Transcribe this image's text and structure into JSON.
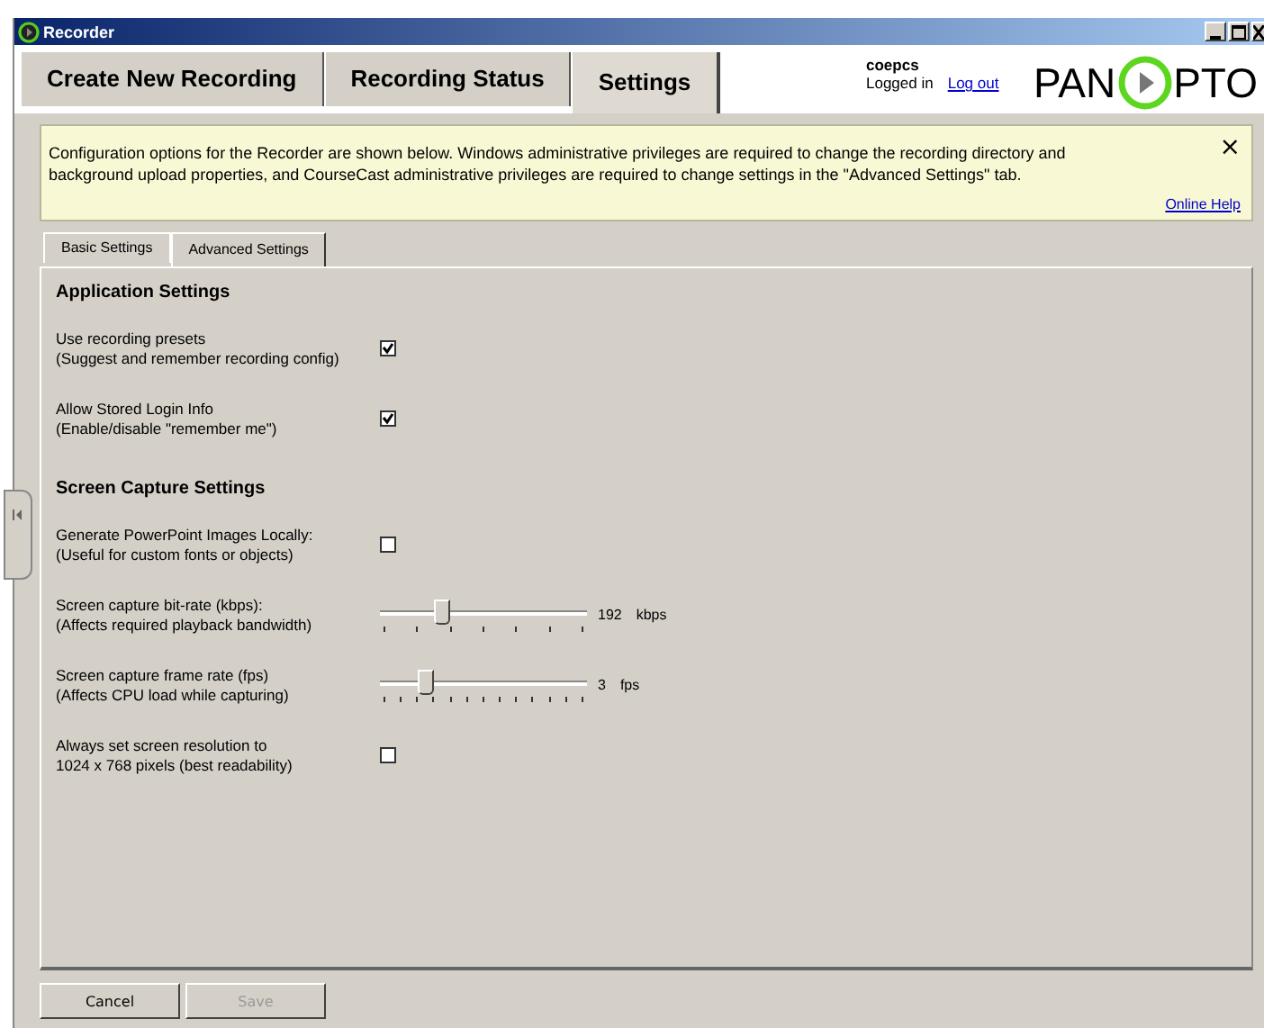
{
  "window": {
    "title": "Recorder"
  },
  "tabs": [
    {
      "label": "Create New Recording",
      "selected": false
    },
    {
      "label": "Recording Status",
      "selected": false
    },
    {
      "label": "Settings",
      "selected": true
    }
  ],
  "user": {
    "name": "coepcs",
    "status": "Logged in",
    "logout": "Log out"
  },
  "logo": {
    "left": "PAN",
    "right": "PTO"
  },
  "notice": {
    "text": "Configuration options for the Recorder are shown below.  Windows administrative privileges are required to change the recording directory and background upload properties, and CourseCast administrative privileges are required to change settings in the \"Advanced Settings\" tab.",
    "close": "×",
    "help": "Online Help"
  },
  "subtabs": [
    {
      "label": "Basic Settings",
      "selected": false
    },
    {
      "label": "Advanced Settings",
      "selected": true
    }
  ],
  "sections": [
    {
      "title": "Application Settings",
      "rows": [
        {
          "kind": "checkbox",
          "label": "Use recording presets",
          "hint": "(Suggest and remember recording config)",
          "checked": true
        },
        {
          "kind": "checkbox",
          "label": "Allow Stored Login Info",
          "hint": "(Enable/disable \"remember me\")",
          "checked": true
        }
      ]
    },
    {
      "title": "Screen Capture Settings",
      "rows": [
        {
          "kind": "checkbox",
          "label": "Generate PowerPoint Images Locally:",
          "hint": "(Useful for custom fonts or objects)",
          "checked": false
        },
        {
          "kind": "slider",
          "label": "Screen capture bit-rate (kbps):",
          "hint": "(Affects required playback bandwidth)",
          "level": 0.26,
          "value": "192",
          "unit": "kbps"
        },
        {
          "kind": "slider",
          "label": "Screen capture frame rate (fps)",
          "hint": "(Affects CPU load while capturing)",
          "level": 0.18,
          "value": "3",
          "unit": "fps"
        },
        {
          "kind": "checkbox",
          "label": "Always set screen resolution to",
          "hint": "1024 x 768 pixels (best readability)",
          "checked": false
        }
      ]
    }
  ],
  "buttons": [
    {
      "label": "Cancel",
      "disabled": false
    },
    {
      "label": "Save",
      "disabled": true
    }
  ]
}
